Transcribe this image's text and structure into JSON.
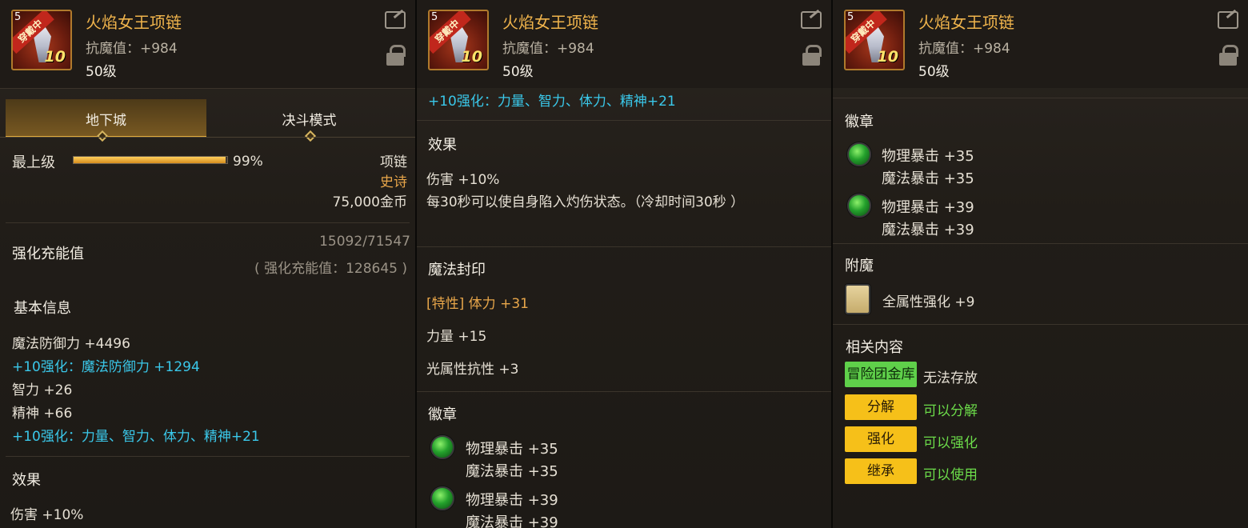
{
  "item": {
    "name": "火焰女王项链",
    "resist": "抗魔值：+984",
    "level": "50级",
    "badge": "穿戴中",
    "enhance_level": "10",
    "corner_digit": "5"
  },
  "panel1": {
    "tabs": [
      "地下城",
      "决斗模式"
    ],
    "grade_label": "最上级",
    "grade_percent": 0.99,
    "grade_percent_text": "99%",
    "slot_type": "项链",
    "rarity": "史诗",
    "price": "75,000金币",
    "charge_title": "强化充能值",
    "charge_progress": "15092/71547",
    "charge_total": "( 强化充能值：128645 )",
    "basic_title": "基本信息",
    "basic_lines": [
      {
        "text": "魔法防御力 +4496",
        "style": "normal"
      },
      {
        "text": "+10强化：魔法防御力 +1294",
        "style": "cyan"
      },
      {
        "text": "智力 +26",
        "style": "normal"
      },
      {
        "text": "精神 +66",
        "style": "normal"
      },
      {
        "text": "+10强化：力量、智力、体力、精神+21",
        "style": "cyan"
      }
    ],
    "effect_title": "效果",
    "effect_cut": "伤害 +10%"
  },
  "panel2": {
    "top_line": "+10强化：力量、智力、体力、精神+21",
    "effect_title": "效果",
    "effect_lines": [
      "伤害 +10%",
      "每30秒可以使自身陷入灼伤状态。（冷却时间30秒 ）"
    ],
    "seal_title": "魔法封印",
    "seal_lines": [
      {
        "text": "[特性] 体力 +31",
        "style": "gold"
      },
      {
        "text": "力量 +15",
        "style": "normal"
      },
      {
        "text": "光属性抗性 +3",
        "style": "normal"
      }
    ],
    "emblem_title": "徽章",
    "emblems": [
      {
        "line1": "物理暴击 +35",
        "line2": "魔法暴击 +35"
      },
      {
        "line1": "物理暴击 +39",
        "line2": "魔法暴击 +39"
      }
    ]
  },
  "panel3": {
    "emblem_title": "徽章",
    "emblems": [
      {
        "line1": "物理暴击 +35",
        "line2": "魔法暴击 +35"
      },
      {
        "line1": "物理暴击 +39",
        "line2": "魔法暴击 +39"
      }
    ],
    "enchant_title": "附魔",
    "enchant": "全属性强化 +9",
    "related_title": "相关内容",
    "related": [
      {
        "button": "冒险团金库",
        "status": "无法存放",
        "kind": "green"
      },
      {
        "button": "分解",
        "status": "可以分解",
        "kind": "yellow"
      },
      {
        "button": "强化",
        "status": "可以强化",
        "kind": "yellow"
      },
      {
        "button": "继承",
        "status": "可以使用",
        "kind": "yellow"
      }
    ]
  },
  "colors": {
    "name": "#f0b44c",
    "cyan": "#3ac8ea",
    "gold": "#e8a64a",
    "green_text": "#6cdc4a",
    "btn_green": "#5fd04a",
    "btn_yellow": "#f6c019"
  },
  "icons": [
    "share-icon",
    "lock-icon",
    "green-emblem-orb-icon",
    "enchant-card-icon"
  ]
}
